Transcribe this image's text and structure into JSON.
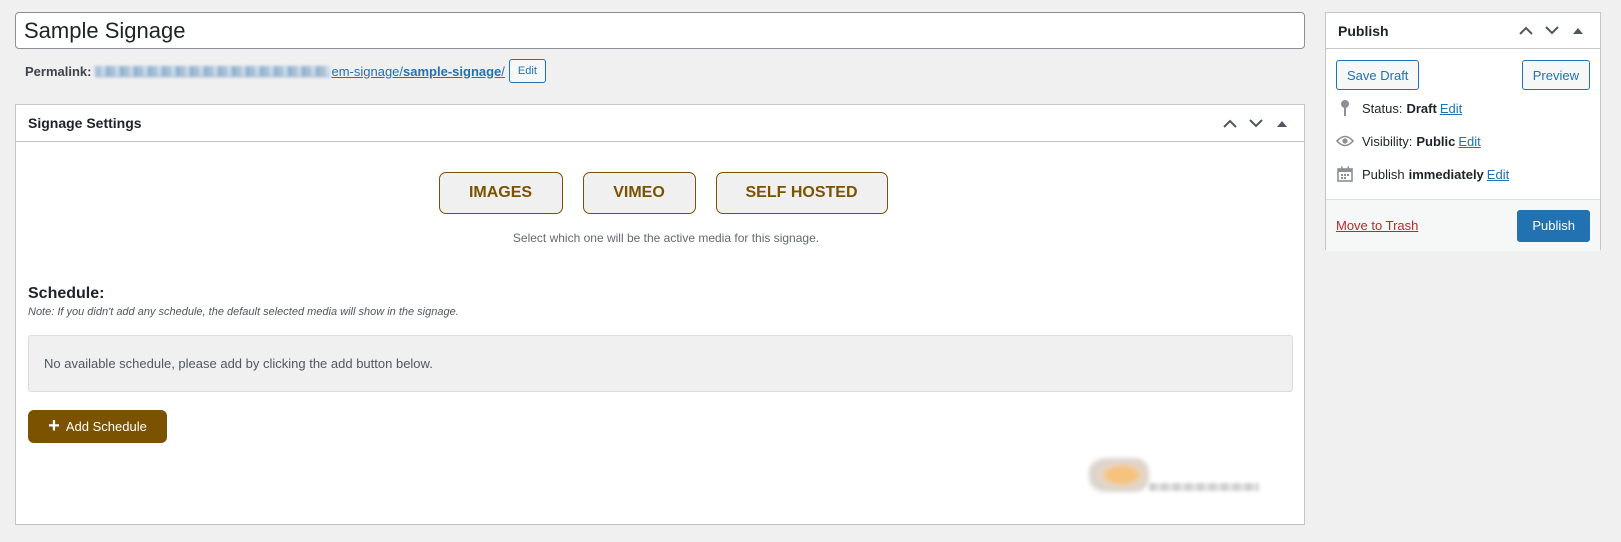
{
  "title_field": {
    "value": "Sample Signage"
  },
  "permalink": {
    "label": "Permalink:",
    "url_mid": "em-signage/",
    "slug": "sample-signage",
    "url_end": "/",
    "edit_label": "Edit"
  },
  "signage_settings": {
    "header": "Signage Settings",
    "media_buttons": [
      "IMAGES",
      "VIMEO",
      "SELF HOSTED"
    ],
    "hint": "Select which one will be the active media for this signage.",
    "schedule_title": "Schedule:",
    "schedule_note": "Note: If you didn't add any schedule, the default selected media will show in the signage.",
    "empty_text": "No available schedule, please add by clicking the add button below.",
    "add_button": "Add Schedule"
  },
  "publish": {
    "header": "Publish",
    "save_draft": "Save Draft",
    "preview": "Preview",
    "status_label": "Status:",
    "status_value": "Draft",
    "visibility_label": "Visibility:",
    "visibility_value": "Public",
    "publish_label": "Publish",
    "publish_value": "immediately",
    "edit_label": "Edit",
    "trash": "Move to Trash",
    "publish_button": "Publish"
  },
  "colors": {
    "accent_brown": "#7a5200",
    "wp_blue": "#2271b1",
    "trash_red": "#b32d2e"
  },
  "icons": [
    "chevron-up-icon",
    "chevron-down-icon",
    "toggle-arrow-icon",
    "pin-icon",
    "eye-icon",
    "calendar-icon",
    "plus-icon"
  ]
}
